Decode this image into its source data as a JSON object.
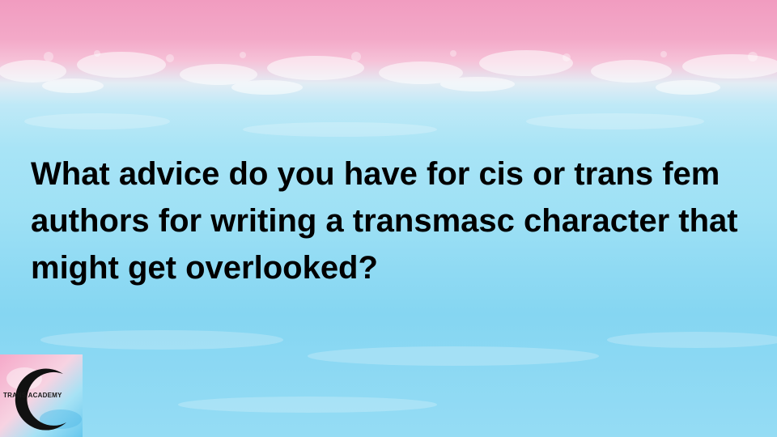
{
  "slide": {
    "question": "What advice do you have for cis or trans fem authors for writing a transmasc character that might get overlooked?",
    "logo_text": "TRANS ACADEMY"
  },
  "colors": {
    "pink": "#f19cc0",
    "white": "#f4f7fa",
    "blue": "#8fdaf3",
    "text": "#000000"
  }
}
